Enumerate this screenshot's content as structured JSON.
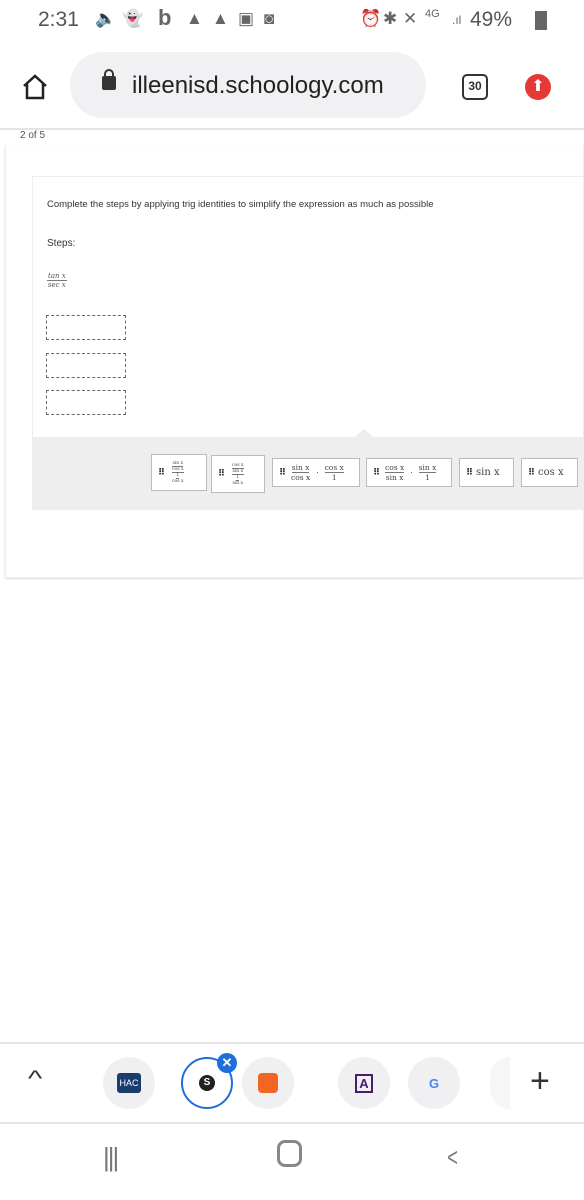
{
  "status_bar": {
    "time": "2:31",
    "battery": "49%",
    "network": "4G",
    "left_icons": [
      "volume-icon",
      "snapchat-icon",
      "b-icon",
      "alert-icon",
      "alert-icon",
      "image-icon",
      "refresh-icon"
    ],
    "right_icons": [
      "alarm-icon",
      "bluetooth-icon",
      "mute-icon",
      "signal-icon",
      "battery-icon"
    ]
  },
  "browser": {
    "url": "illeenisd.schoology.com",
    "tab_count": "30"
  },
  "question": {
    "progress": "2 of 5",
    "instruction": "Complete the steps by applying trig identities to simplify the expression as much as possible",
    "steps_label": "Steps:",
    "given": {
      "numerator": "tan x",
      "denominator": "sec x"
    },
    "drop_slots": 3
  },
  "answer_bank": [
    {
      "type": "complex",
      "num_num": "sin x",
      "num_den": "cos x",
      "den_num": "1",
      "den_den": "cos x"
    },
    {
      "type": "complex",
      "num_num": "cos x",
      "num_den": "sin x",
      "den_num": "1",
      "den_den": "sin x"
    },
    {
      "type": "product",
      "a_num": "sin x",
      "a_den": "cos x",
      "op": "·",
      "b_num": "cos x",
      "b_den": "1"
    },
    {
      "type": "product",
      "a_num": "cos x",
      "a_den": "sin x",
      "op": "·",
      "b_num": "sin x",
      "b_den": "1"
    },
    {
      "type": "text",
      "text": "sin x"
    },
    {
      "type": "text",
      "text": "cos x"
    }
  ],
  "tab_strip": {
    "items": [
      "HAC",
      "S",
      "soundcloud",
      "A",
      "G"
    ],
    "active": "S",
    "add_label": "+"
  },
  "nav": {
    "recent": "|||",
    "home": "○",
    "back": "<"
  }
}
